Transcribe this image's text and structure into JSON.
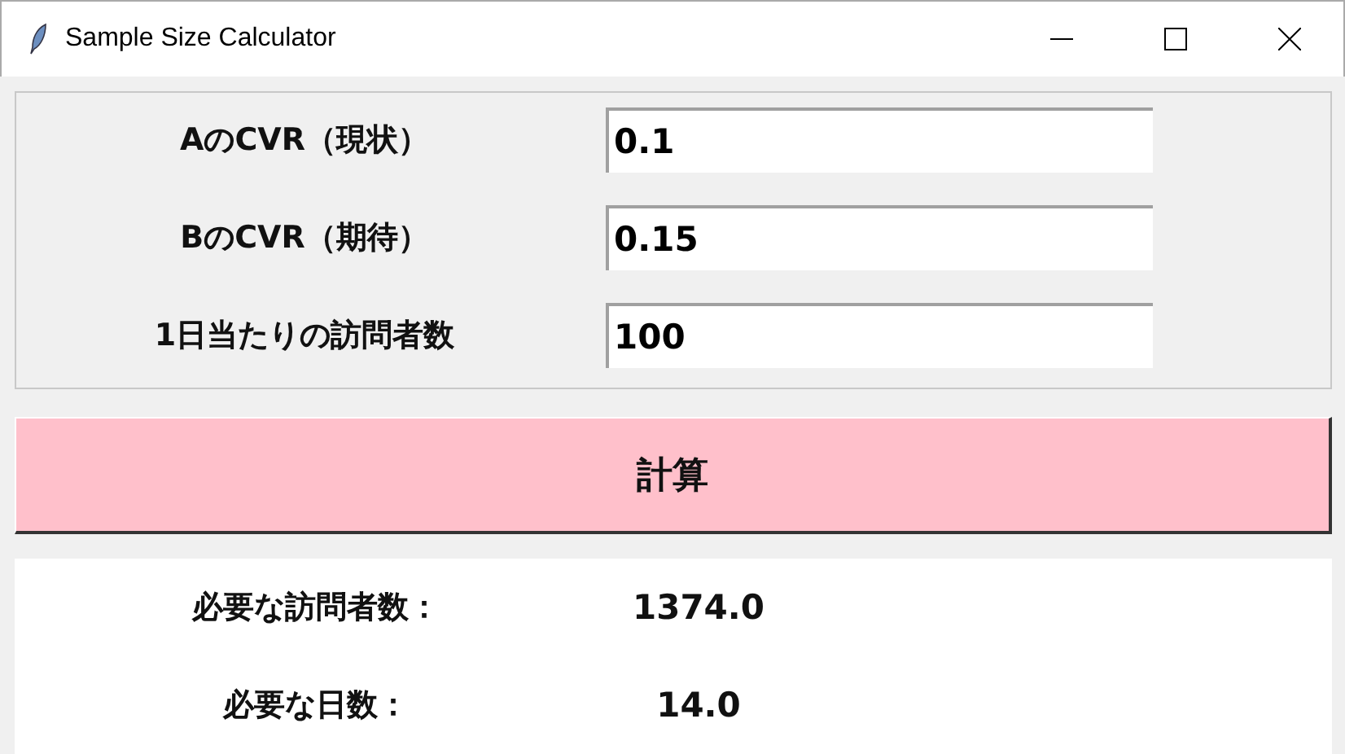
{
  "window": {
    "title": "Sample Size Calculator"
  },
  "inputs": [
    {
      "label": "AのCVR（現状）",
      "value": "0.1"
    },
    {
      "label": "BのCVR（期待）",
      "value": "0.15"
    },
    {
      "label": "1日当たりの訪問者数",
      "value": "100"
    }
  ],
  "button": {
    "label": "計算"
  },
  "results": [
    {
      "label": "必要な訪問者数：",
      "value": "1374.0"
    },
    {
      "label": "必要な日数：",
      "value": "14.0"
    }
  ]
}
